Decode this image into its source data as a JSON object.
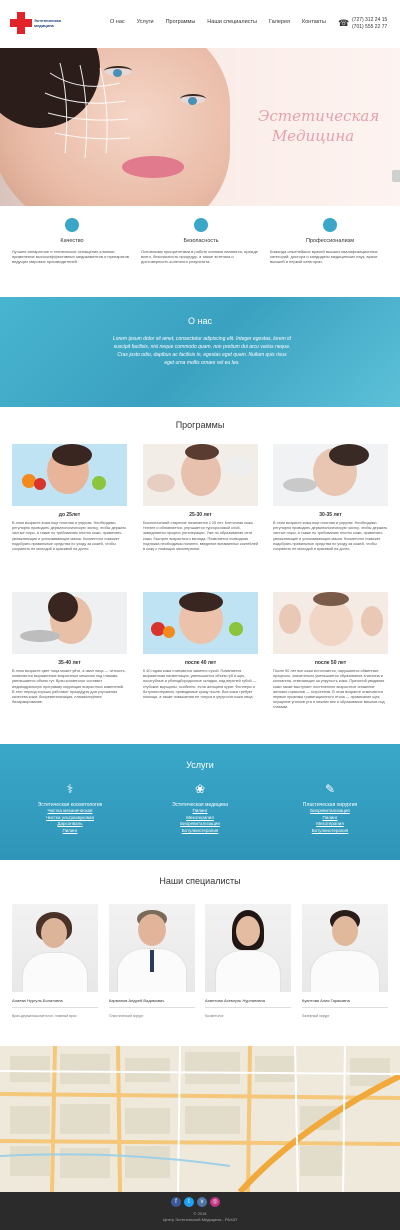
{
  "header": {
    "logo_text": "Эстетическая медицина",
    "nav": [
      "О нас",
      "Услуги",
      "Программы",
      "Наши специалисты",
      "Галерея",
      "Контакты"
    ],
    "phones": [
      "(727) 312 24 15",
      "(701) 555 22 77"
    ]
  },
  "hero": {
    "title_line1": "Эстетическая",
    "title_line2": "Медицина"
  },
  "features": [
    {
      "title": "Качество",
      "icon": "medal-icon",
      "text": "Лучшее аппаратное и техническое оснащение клиники, применение высокоэффективных медикаментов и препаратов ведущих мировых производителей."
    },
    {
      "title": "Безопасность",
      "icon": "shield-heart-icon",
      "text": "Основными приоритетами в работе клиники являются, прежде всего, безопасность процедур, а также эстетика и достоверность конечного результата."
    },
    {
      "title": "Профессионализм",
      "icon": "team-icon",
      "text": "Команда опытнейших врачей высших квалификационных категорий: доктора и кандидаты медицинских наук, врачи высшей и первой категории."
    }
  ],
  "about": {
    "title": "О нас",
    "text": "Lorem ipsum dolor sit amet, consectetur adipiscing elit. Integer egestas, lorem id suscipit facilisis, nisi neque commodo quam, non pretium dui arcu varius neque. Cras justo odio, dapibus ac facilisis in, egestas eget quam. Nullam quis risus eget urna mollis ornare vel eu leo."
  },
  "programs": {
    "title": "Программы",
    "items": [
      {
        "caption": "до 25лет",
        "text": "В этом возрасте кожа еще плотная и упругая. Необходимо регулярно проводить дерматологическую чистку, чтобы держать чистые поры, а также по требованию плотно кожи, применять увлажняющие и успокаивающие маски. Косметолог поможет подобрать правильные средства по уходу за кожей, чтобы сохранить ее молодой и красивой на долго."
      },
      {
        "caption": "25-30 лет",
        "text": "Биологический старение начинается с 25 лет. Клеточная кожа теплее и обновляется, улучшается тургоросовый слой, замедляется процесс регенерации. Уже по образованию сети кожи, быстрее возрастного взгляда. Появляется очевидная подтяжка необходимы пилинги, введение витаминных коктейлей в кожу с помощью мезотерапии."
      },
      {
        "caption": "30-35 лет",
        "text": "В этом возрасте кожа еще плотная и упругая. Необходимо регулярно проводить дерматологическую чистку, чтобы держать чистые поры, а также по требованию плотно кожи, применять увлажняющие и успокаивающие маски. Косметолог поможет подобрать правильные средства по уходу за кожей, чтобы сохранить ее молодой и красивой на долго."
      },
      {
        "caption": "35-40 лет",
        "text": "В этом возрасте цвет лица может уйти, а овал лица — четкость, появляются выраженные возрастные мешочки под глазами, уменьшается объем тут. Врач косметолог составит индивидуальную программу коррекции возрастных изменений. В этот период хорошо работают процедуры для улучшения качества кожи: биоревитализация, плазмолифтинг, биоармирование."
      },
      {
        "caption": "после 40 лет",
        "text": "К 40 годам кожа становится заметно сухой. Появляется выраженная пигментация, уменьшается объем губ и щек, носогубные и убэподбородочные складки, над верхней губой — глубокие морщины, особенно, если женщина курит. Филлеры и ботулинотерапия, проводимые сразу после. Вся кожа требует помощи, а также повышения ее тонуса и упругости кожи лица."
      },
      {
        "caption": "после 50 лет",
        "text": "После 50 лет все кожи истончается, нарушаются обменные процессы, значительно уменьшается образование эластина и коллагена, отвечающих за упругость кожи. Причиной увядания кожи также выступает постепенное возрастное снижение женских гормонов — эстрогенов. В этом возрасте отмечаются первые признаки гравитационного птоза — провисание щек, опущение уголков рта и нижних век и образование мешков под глазами."
      }
    ]
  },
  "services": {
    "title": "Услуги",
    "columns": [
      {
        "title": "Эстетическая косметология",
        "icon": "cosmetology-icon",
        "items": [
          "Чистка механическая",
          "Чистка ультразвуковая",
          "Дарсонваль",
          "Пилинг"
        ]
      },
      {
        "title": "Эстетическая медицина",
        "icon": "lotus-icon",
        "items": [
          "Пилинг",
          "Мезотерапия",
          "Биоревитализация",
          "Ботулинотерапия"
        ]
      },
      {
        "title": "Пластическая хирургия",
        "icon": "scalpel-icon",
        "items": [
          "Биоревитализация",
          "Пилинг",
          "Мезотерапия",
          "Ботулинотерапия"
        ]
      }
    ]
  },
  "specialists": {
    "title": "Наши специалисты",
    "items": [
      {
        "name": "Алиева Нургуль Болатовна",
        "role": "Врач-дерматокосметолог, главный врач"
      },
      {
        "name": "Карманов Андрей Вадимович",
        "role": "Пластический хирург"
      },
      {
        "name": "Ахметова Асемгуль Нурлановна",
        "role": "Косметолог"
      },
      {
        "name": "Куантова Алия Гараковна",
        "role": "Лазерный хирург"
      }
    ]
  },
  "footer": {
    "copyright": "© 2016",
    "org": "Центр Эстетической Медицины - РАХАТ",
    "socials": [
      "facebook-icon",
      "twitter-icon",
      "vk-icon",
      "instagram-icon"
    ]
  }
}
